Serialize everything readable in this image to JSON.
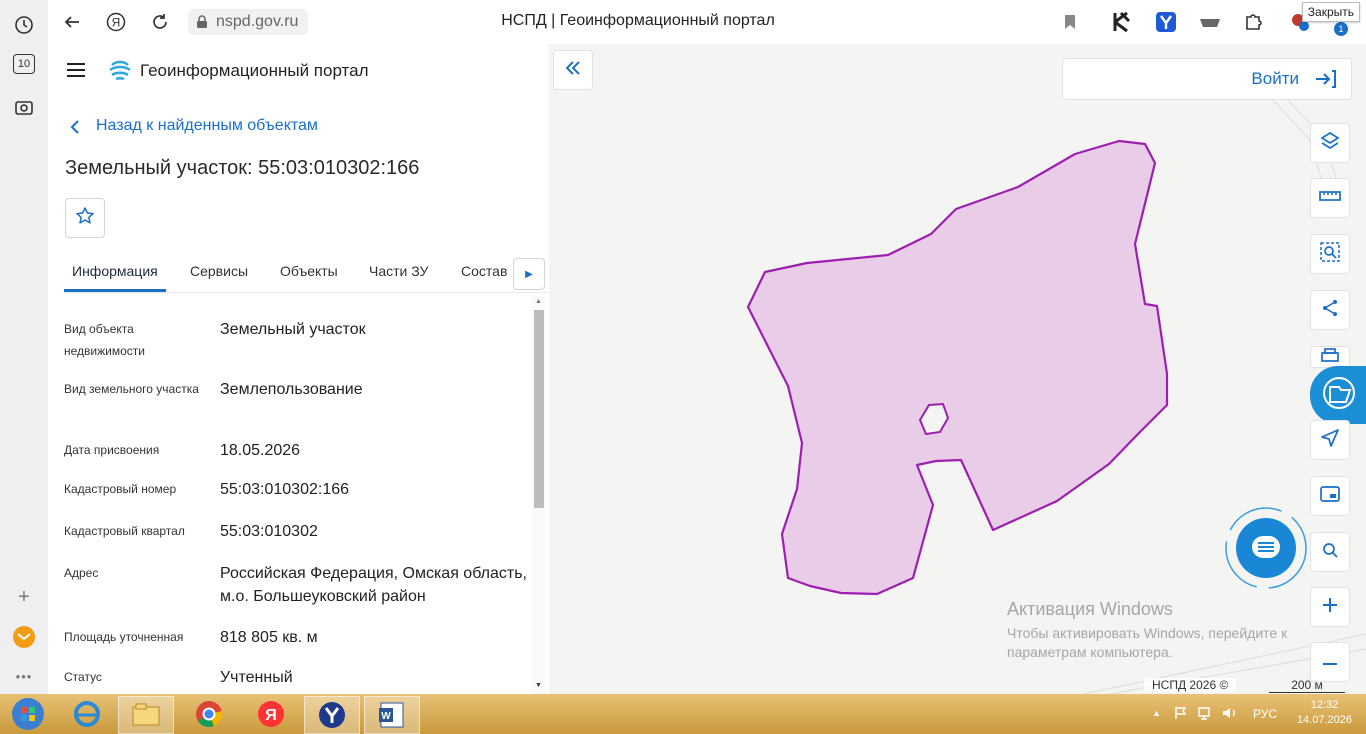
{
  "browser": {
    "url": "nspd.gov.ru",
    "page_title": "НСПД | Геоинформационный портал",
    "close_tooltip": "Закрыть",
    "rail_badge": "10",
    "ext_badge": "1"
  },
  "header": {
    "title": "Геоинформационный портал"
  },
  "panel": {
    "back_link": "Назад к найденным объектам",
    "object_title": "Земельный участок: 55:03:010302:166",
    "tabs": [
      "Информация",
      "Сервисы",
      "Объекты",
      "Части ЗУ",
      "Состав"
    ],
    "active_tab": "Информация",
    "properties": [
      {
        "label": "Вид объекта недвижимости",
        "value": "Земельный участок"
      },
      {
        "label": "Вид земельного участка",
        "value": "Землепользование"
      },
      {
        "label": "Дата присвоения",
        "value": "18.05.2026"
      },
      {
        "label": "Кадастровый номер",
        "value": "55:03:010302:166"
      },
      {
        "label": "Кадастровый квартал",
        "value": "55:03:010302"
      },
      {
        "label": "Адрес",
        "value": "Российская Федерация, Омская область, м.о. Большеуковский район"
      },
      {
        "label": "Площадь уточненная",
        "value": "818 805 кв. м"
      },
      {
        "label": "Статус",
        "value": "Учтенный"
      }
    ]
  },
  "map": {
    "login_label": "Войти",
    "activation_title": "Активация Windows",
    "activation_text": "Чтобы активировать Windows, перейдите к параметрам компьютера.",
    "copyright": "НСПД 2026 ©",
    "scale_label": "200 м",
    "parcel_fill": "#e8cce8",
    "parcel_stroke": "#9c1fb0"
  },
  "taskbar": {
    "language": "РУС",
    "time": "12:32",
    "date": "14.07.2026"
  },
  "colors": {
    "accent": "#1a6fc9",
    "taskbar": "#d9ad5a"
  }
}
